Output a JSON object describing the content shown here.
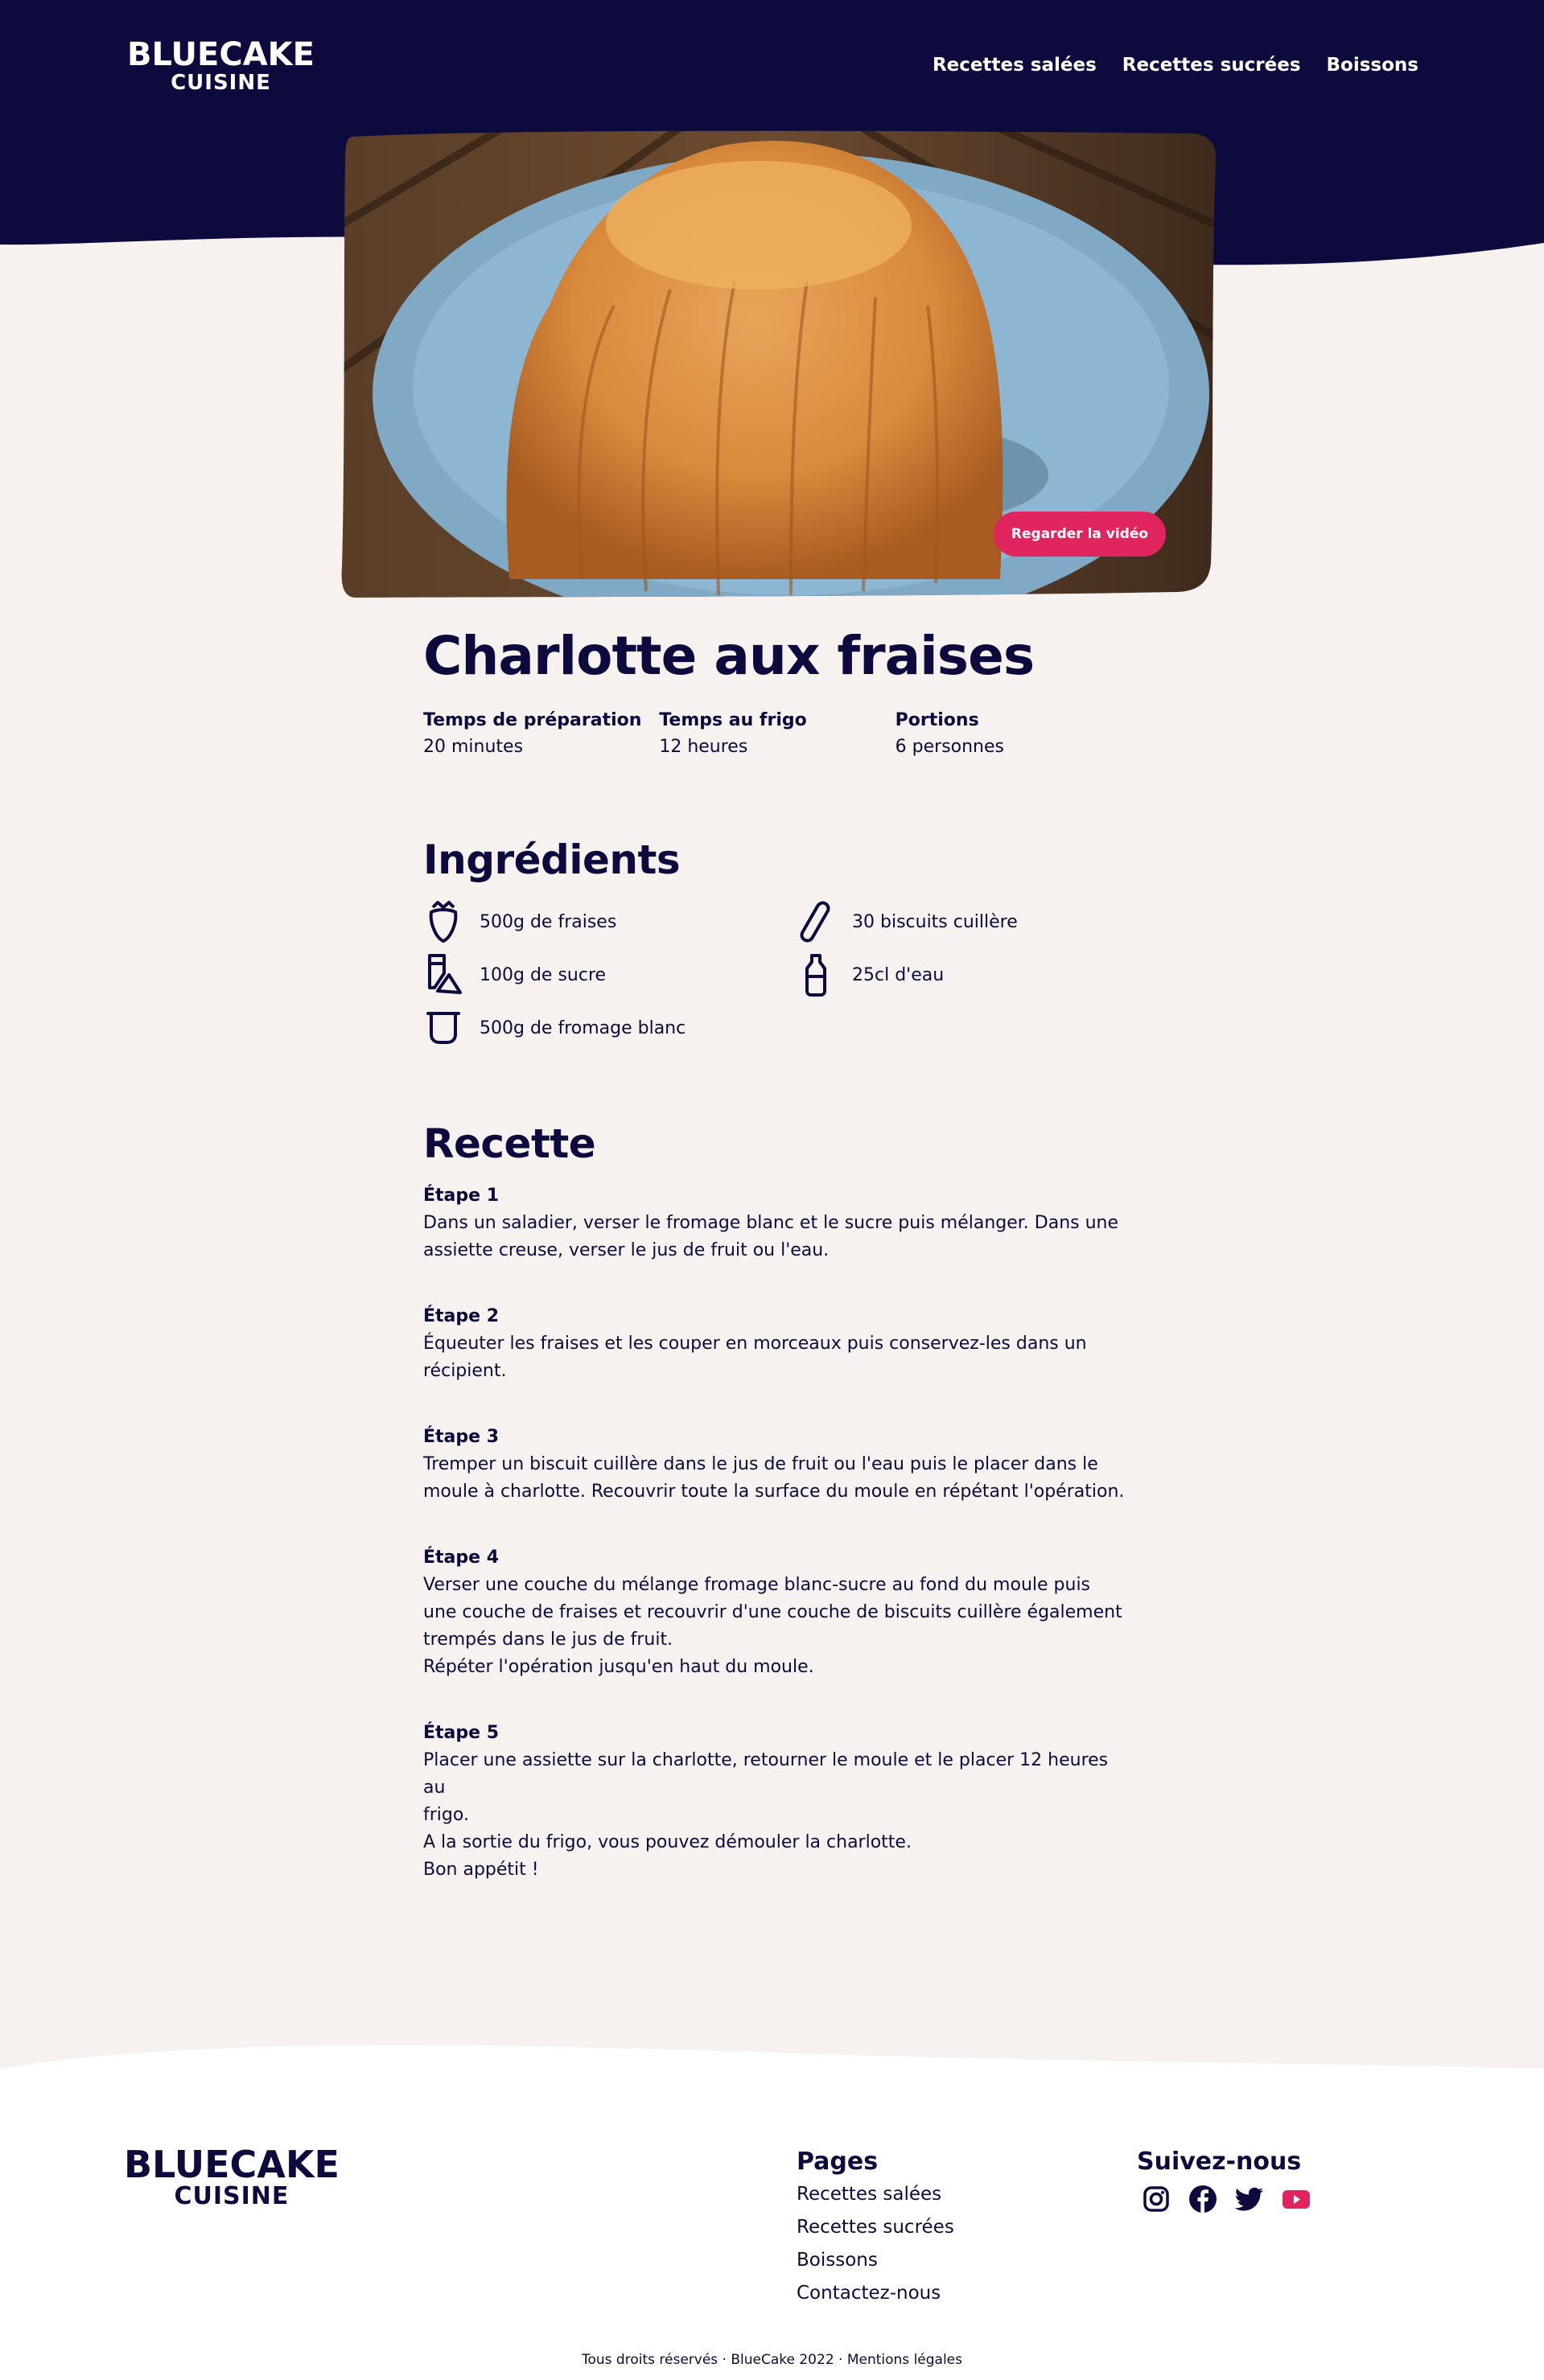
{
  "colors": {
    "navy": "#0d0b3d",
    "background": "#f7f2ef",
    "accent": "#e0245e",
    "white": "#ffffff"
  },
  "header": {
    "logo_line1": "BLUECAKE",
    "logo_line2": "CUISINE",
    "nav": [
      "Recettes salées",
      "Recettes sucrées",
      "Boissons"
    ]
  },
  "hero": {
    "video_button": "Regarder la vidéo"
  },
  "recipe": {
    "title": "Charlotte aux fraises",
    "meta": [
      {
        "label": "Temps de préparation",
        "value": "20 minutes"
      },
      {
        "label": "Temps au frigo",
        "value": "12 heures"
      },
      {
        "label": "Portions",
        "value": "6 personnes"
      }
    ],
    "ingredients_title": "Ingrédients",
    "ingredients": [
      {
        "icon": "strawberry-icon",
        "text": "500g de fraises"
      },
      {
        "icon": "sugar-icon",
        "text": "100g de sucre"
      },
      {
        "icon": "fromage-blanc-icon",
        "text": "500g de fromage blanc"
      },
      {
        "icon": "biscuit-icon",
        "text": "30 biscuits cuillère"
      },
      {
        "icon": "bottle-icon",
        "text": "25cl d'eau"
      }
    ],
    "recipe_title": "Recette",
    "steps": [
      {
        "title": "Étape 1",
        "lines": [
          "Dans un saladier, verser le fromage blanc et le sucre puis mélanger. Dans une",
          "assiette creuse, verser le jus de fruit ou l'eau."
        ]
      },
      {
        "title": "Étape 2",
        "lines": [
          "Équeuter les fraises et les couper en morceaux puis conservez-les dans un",
          "récipient."
        ]
      },
      {
        "title": "Étape 3",
        "lines": [
          "Tremper un biscuit cuillère dans le jus de fruit ou l'eau puis le placer dans le",
          "moule à charlotte. Recouvrir toute la surface du moule en répétant l'opération."
        ]
      },
      {
        "title": "Étape 4",
        "lines": [
          "Verser une couche du mélange fromage blanc-sucre au fond du moule puis",
          "une couche de fraises et recouvrir d'une couche de biscuits cuillère également",
          "trempés dans le jus de fruit.",
          "Répéter l'opération jusqu'en haut du moule."
        ]
      },
      {
        "title": "Étape 5",
        "lines": [
          "Placer une assiette sur la charlotte, retourner le moule et le placer 12 heures au",
          "frigo.",
          "A la sortie du frigo, vous pouvez démouler la charlotte.",
          "Bon appétit !"
        ]
      }
    ]
  },
  "footer": {
    "logo_line1": "BLUECAKE",
    "logo_line2": "CUISINE",
    "pages_title": "Pages",
    "pages": [
      "Recettes salées",
      "Recettes sucrées",
      "Boissons",
      "Contactez-nous"
    ],
    "social_title": "Suivez-nous",
    "social": [
      "instagram-icon",
      "facebook-icon",
      "twitter-icon",
      "youtube-icon"
    ],
    "copyright": "Tous droits réservés · BlueCake 2022 · Mentions légales"
  }
}
